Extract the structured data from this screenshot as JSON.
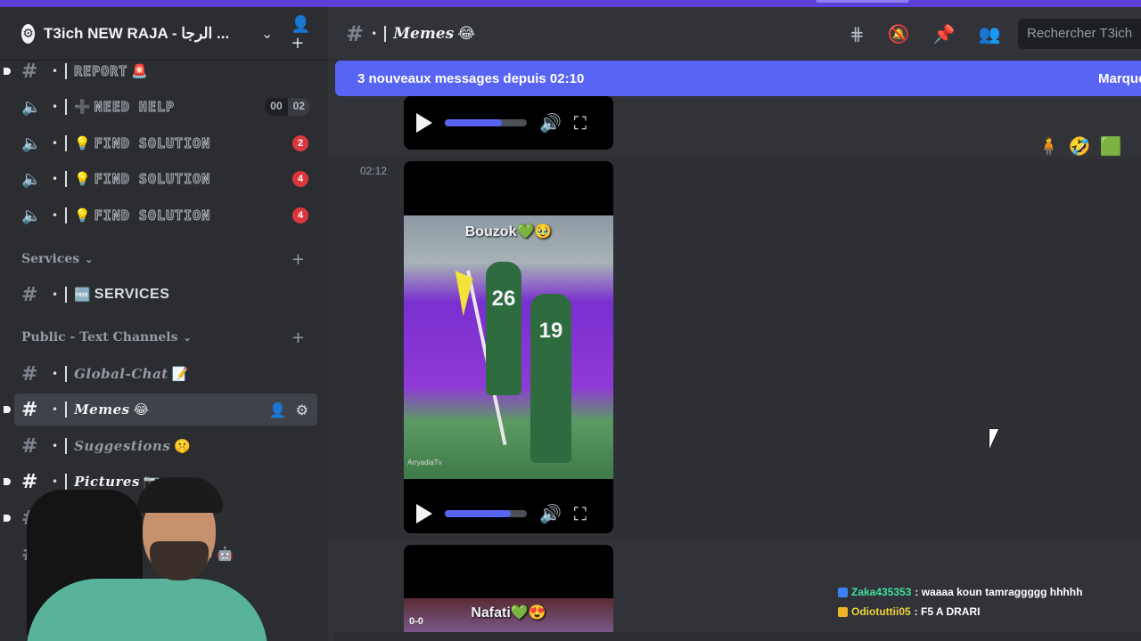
{
  "server": {
    "name": "T3ich NEW RAJA - الرجا ...",
    "icon": "server-gear-icon"
  },
  "sidebar": {
    "channels_top": [
      {
        "kind": "text",
        "label": "REPORT",
        "trail": "🚨",
        "style": "outline"
      },
      {
        "kind": "voice",
        "prefix": "➕",
        "label": "NEED HELP",
        "style": "outline",
        "count_a": "00",
        "count_b": "02"
      },
      {
        "kind": "voice",
        "prefix": "💡",
        "label": "FIND SOLUTION",
        "style": "outline",
        "badge": "2"
      },
      {
        "kind": "voice",
        "prefix": "💡",
        "label": "FIND SOLUTION",
        "style": "outline",
        "badge": "4"
      },
      {
        "kind": "voice",
        "prefix": "💡",
        "label": "FIND SOLUTION",
        "style": "outline",
        "badge": "4"
      }
    ],
    "category_services": "Services",
    "services_channel": {
      "prefix": "🆓",
      "label": "SERVICES"
    },
    "category_public": "Public - Text Channels",
    "public_channels": [
      {
        "label": "Global-Chat",
        "trail": "📝"
      },
      {
        "label": "Memes",
        "trail": "😂"
      },
      {
        "label": "Suggestions",
        "trail": "🤫"
      },
      {
        "label": "Pictures",
        "trail": "📷"
      }
    ],
    "partial_label": "s"
  },
  "main": {
    "channel_name": "Memes",
    "channel_emoji": "😂",
    "search_placeholder": "Rechercher T3ich",
    "new_messages_banner": "3 nouveaux messages depuis 02:10",
    "mark_read": "Marquer",
    "timestamp": "02:12",
    "video1": {
      "volume": 0.7
    },
    "video2": {
      "caption": "Bouzok💚🥹",
      "shirt_left": "26",
      "shirt_right": "19",
      "watermark": "ArryadiaTv",
      "volume": 0.8
    },
    "video3": {
      "caption": "Nafati💚😍",
      "score": "0-0"
    },
    "reactions": [
      "🧍",
      "🤣",
      "🟩"
    ]
  },
  "stream_chat": [
    {
      "user": "Zaka435353",
      "message": ": waaaa koun tamraggggg hhhhh",
      "badge_color": "#3b82f6"
    },
    {
      "user": "Odiotuttii05",
      "message": ": F5 A DRARI",
      "badge_color": "#f0b429"
    }
  ],
  "colors": {
    "accent": "#5865f2",
    "unread_badge": "#da373c",
    "top_accent": "#5b3fd6"
  }
}
